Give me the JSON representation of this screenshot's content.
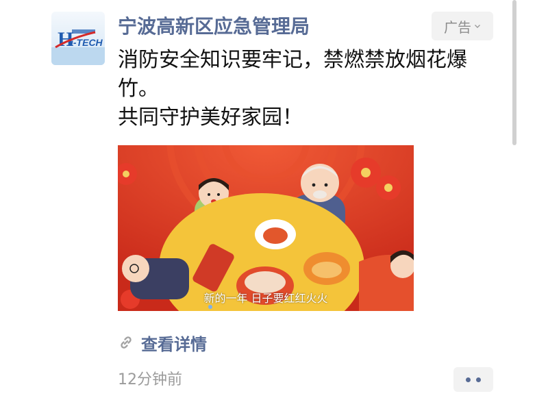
{
  "post": {
    "account_name": "宁波高新区应急管理局",
    "ad_label": "广告",
    "body_lines": [
      "消防安全知识要牢记，禁燃禁放烟花爆竹。",
      "共同守护美好家园！"
    ],
    "video": {
      "subtitle": "新的一年 日子要红红火火"
    },
    "detail_link_label": "查看详情",
    "timestamp": "12分钟前"
  },
  "avatar": {
    "logo_text": "i-TECH",
    "icon": "hi-tech-logo"
  },
  "icons": {
    "ad_menu": "chevron-down-icon",
    "detail_link": "link-icon",
    "more": "more-dots-icon"
  },
  "colors": {
    "account_name": "#576b95",
    "link": "#576b95",
    "body_text": "#111111",
    "meta_text": "#9b9b9b",
    "video_background": "#d9341f"
  }
}
